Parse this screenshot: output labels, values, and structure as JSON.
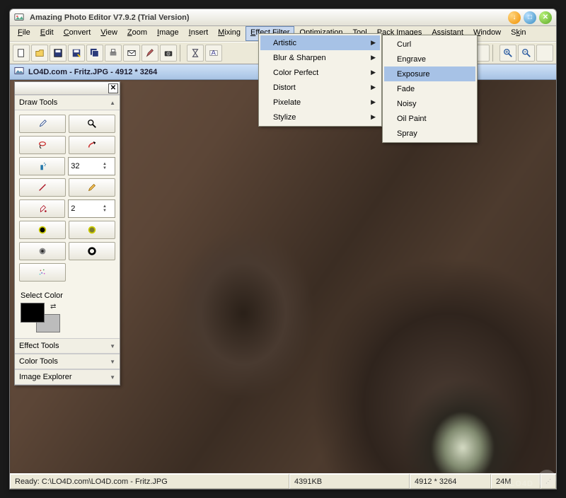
{
  "title": "Amazing Photo Editor V7.9.2 (Trial Version)",
  "menubar": [
    "File",
    "Edit",
    "Convert",
    "View",
    "Zoom",
    "Image",
    "Insert",
    "Mixing",
    "Effect Filter",
    "Optimization",
    "Tool",
    "Pack Images",
    "Assistant",
    "Window",
    "Skin"
  ],
  "menubar_underline_index": [
    0,
    0,
    0,
    0,
    0,
    0,
    0,
    0,
    0,
    0,
    0,
    0,
    0,
    0,
    1
  ],
  "active_menu_index": 8,
  "doc_title": "LO4D.com - Fritz.JPG - 4912 * 3264",
  "submenu1": [
    {
      "label": "Artistic",
      "has_children": true,
      "highlight": true
    },
    {
      "label": "Blur & Sharpen",
      "has_children": true
    },
    {
      "label": "Color Perfect",
      "has_children": true
    },
    {
      "label": "Distort",
      "has_children": true
    },
    {
      "label": "Pixelate",
      "has_children": true
    },
    {
      "label": "Stylize",
      "has_children": true
    }
  ],
  "submenu2": [
    {
      "label": "Curl"
    },
    {
      "label": "Engrave"
    },
    {
      "label": "Exposure",
      "highlight": true
    },
    {
      "label": "Fade"
    },
    {
      "label": "Noisy"
    },
    {
      "label": "Oil Paint"
    },
    {
      "label": "Spray"
    }
  ],
  "palette": {
    "sections": {
      "draw": "Draw Tools",
      "effect": "Effect Tools",
      "color": "Color Tools",
      "explorer": "Image Explorer"
    },
    "select_color_label": "Select Color",
    "brush_size": "32",
    "stroke_size": "2"
  },
  "status": {
    "ready": "Ready: C:\\LO4D.com\\LO4D.com - Fritz.JPG",
    "kb": "4391KB",
    "dim": "4912 * 3264",
    "mem": "24M"
  },
  "watermark": "vLO4D"
}
